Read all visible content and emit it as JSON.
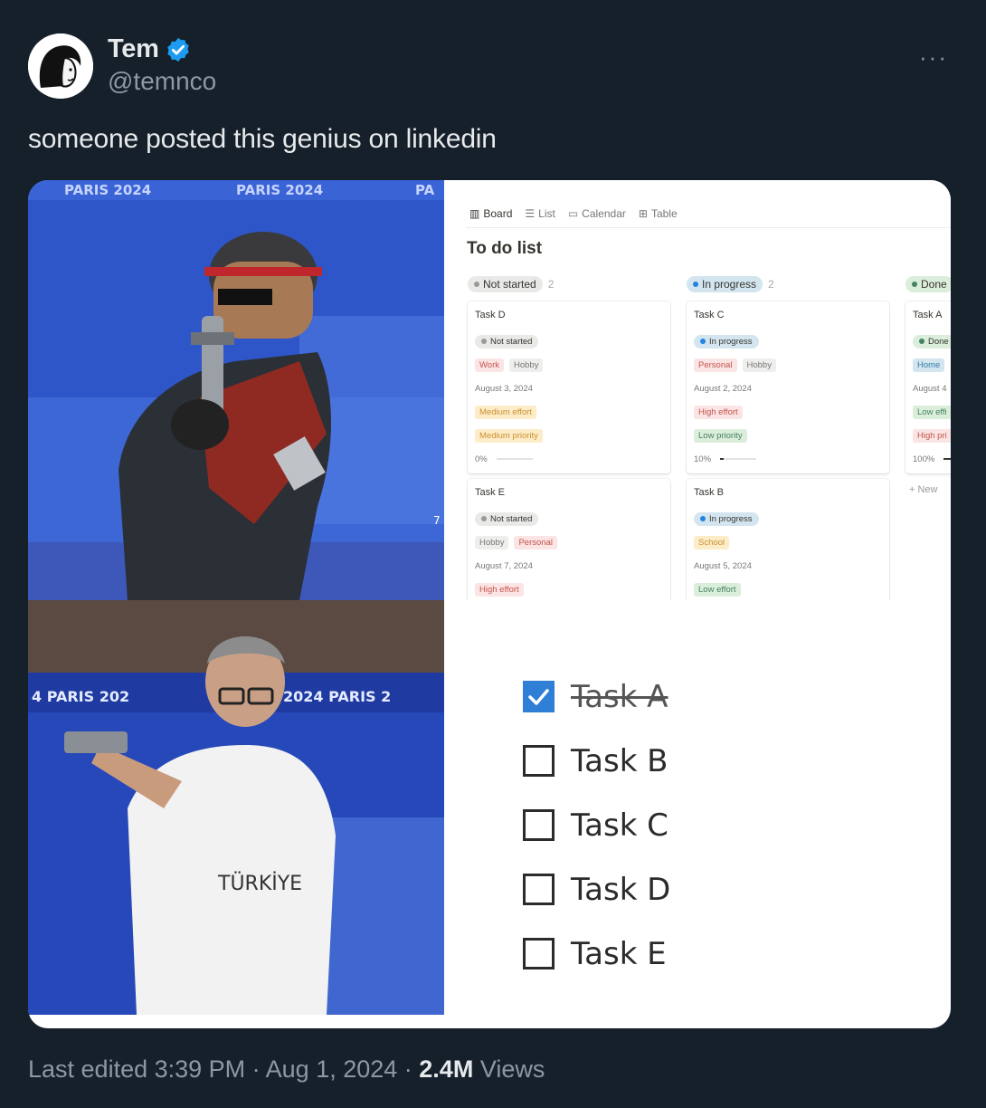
{
  "author": {
    "name": "Tem",
    "handle": "@temnco",
    "verified": true
  },
  "more_label": "···",
  "tweet_text": "someone posted this genius on linkedin",
  "top_photo": {
    "banner_text_1": "PARIS 2024",
    "banner_text_2": "PARIS 2024",
    "banner_text_3": "PA",
    "lane_number": "7"
  },
  "bottom_photo": {
    "banner_left": "4  PARIS 202",
    "banner_right": "2024  PARIS 2",
    "shirt_text": "TÜRKİYE"
  },
  "board": {
    "views": [
      "Board",
      "List",
      "Calendar",
      "Table"
    ],
    "title": "To do list",
    "columns": [
      {
        "name": "Not started",
        "count": "2",
        "color": "#9b9a97",
        "bg": "#e9e9e7",
        "cards": [
          {
            "title": "Task D",
            "status": "Not started",
            "tags": [
              "Work",
              "Hobby"
            ],
            "date": "August 3, 2024",
            "effort": "Medium effort",
            "priority": "Medium priority",
            "progress": "0%"
          },
          {
            "title": "Task E",
            "status": "Not started",
            "tags": [
              "Hobby",
              "Personal"
            ],
            "date": "August 7, 2024",
            "effort": "High effort"
          }
        ]
      },
      {
        "name": "In progress",
        "count": "2",
        "color": "#2383e2",
        "bg": "#d3e5ef",
        "cards": [
          {
            "title": "Task C",
            "status": "In progress",
            "tags": [
              "Personal",
              "Hobby"
            ],
            "date": "August 2, 2024",
            "effort": "High effort",
            "priority": "Low priority",
            "progress": "10%"
          },
          {
            "title": "Task B",
            "status": "In progress",
            "tags": [
              "School"
            ],
            "date": "August 5, 2024",
            "effort": "Low effort"
          }
        ]
      },
      {
        "name": "Done",
        "color": "#448361",
        "bg": "#dbeddb",
        "cards": [
          {
            "title": "Task A",
            "status": "Done",
            "tags": [
              "Home"
            ],
            "date": "August 4",
            "effort": "Low effi",
            "priority": "High pri",
            "progress": "100%"
          }
        ],
        "new_label": "+ New"
      }
    ]
  },
  "checklist": [
    {
      "label": "Task A",
      "checked": true
    },
    {
      "label": "Task B",
      "checked": false
    },
    {
      "label": "Task C",
      "checked": false
    },
    {
      "label": "Task D",
      "checked": false
    },
    {
      "label": "Task E",
      "checked": false
    }
  ],
  "footer": {
    "edited": "Last edited 3:39 PM · Aug 1, 2024 · ",
    "views_count": "2.4M",
    "views_label": " Views"
  },
  "colors": {
    "background": "#15202b",
    "verified": "#1d9bf0",
    "check_blue": "#2f7fd6"
  }
}
